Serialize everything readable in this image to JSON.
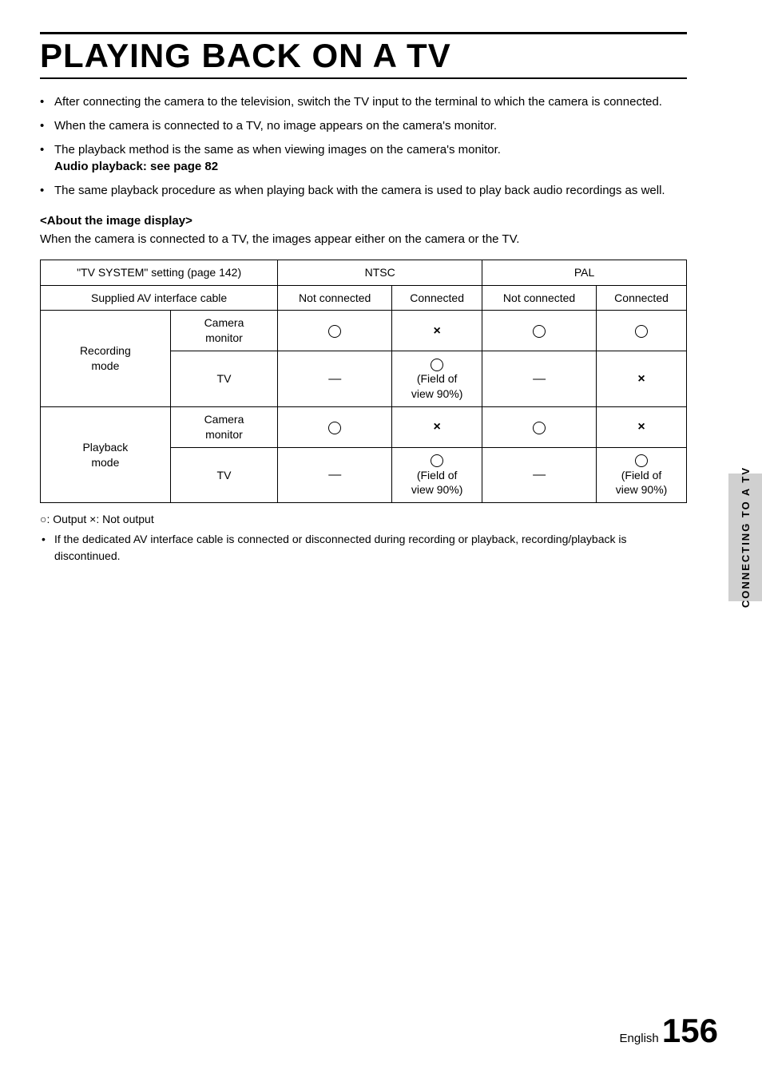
{
  "page": {
    "title": "PLAYING BACK ON A TV",
    "bullets": [
      "After connecting the camera to the television, switch the TV input to the terminal to which the camera is connected.",
      "When the camera is connected to a TV, no image appears on the camera's monitor.",
      "The playback method is the same as when viewing images on the camera's monitor.",
      "The same playback procedure as when playing back with the camera is used to play back audio recordings as well."
    ],
    "audio_playback_bold": "Audio playback: see page 82",
    "section_heading": "<About the image display>",
    "section_body": "When the camera is connected to a TV, the images appear either on the camera or the TV.",
    "table": {
      "col1_header": "\"TV SYSTEM\" setting (page 142)",
      "col2_header": "NTSC",
      "col3_header": "PAL",
      "sub_col_not_connected": "Not connected",
      "sub_col_connected": "Connected",
      "row_groups": [
        {
          "group_label": "Recording mode",
          "rows": [
            {
              "sub_label": "Camera monitor",
              "ntsc_not": "circle",
              "ntsc_conn": "x",
              "pal_not": "circle",
              "pal_conn": "circle"
            },
            {
              "sub_label": "TV",
              "ntsc_not": "dash",
              "ntsc_conn": "circle_field",
              "pal_not": "dash",
              "pal_conn": "x"
            }
          ]
        },
        {
          "group_label": "Playback mode",
          "rows": [
            {
              "sub_label": "Camera monitor",
              "ntsc_not": "circle",
              "ntsc_conn": "x",
              "pal_not": "circle",
              "pal_conn": "x"
            },
            {
              "sub_label": "TV",
              "ntsc_not": "dash",
              "ntsc_conn": "circle_field",
              "pal_not": "dash",
              "pal_conn": "circle_field"
            }
          ]
        }
      ]
    },
    "footnote_symbols": "○: Output  ×: Not output",
    "footnote_bullet": "If the dedicated AV interface cable is connected or disconnected during recording or playback, recording/playback is discontinued.",
    "sidebar_text": "CONNECTING TO A TV",
    "page_label": "English",
    "page_number": "156"
  }
}
